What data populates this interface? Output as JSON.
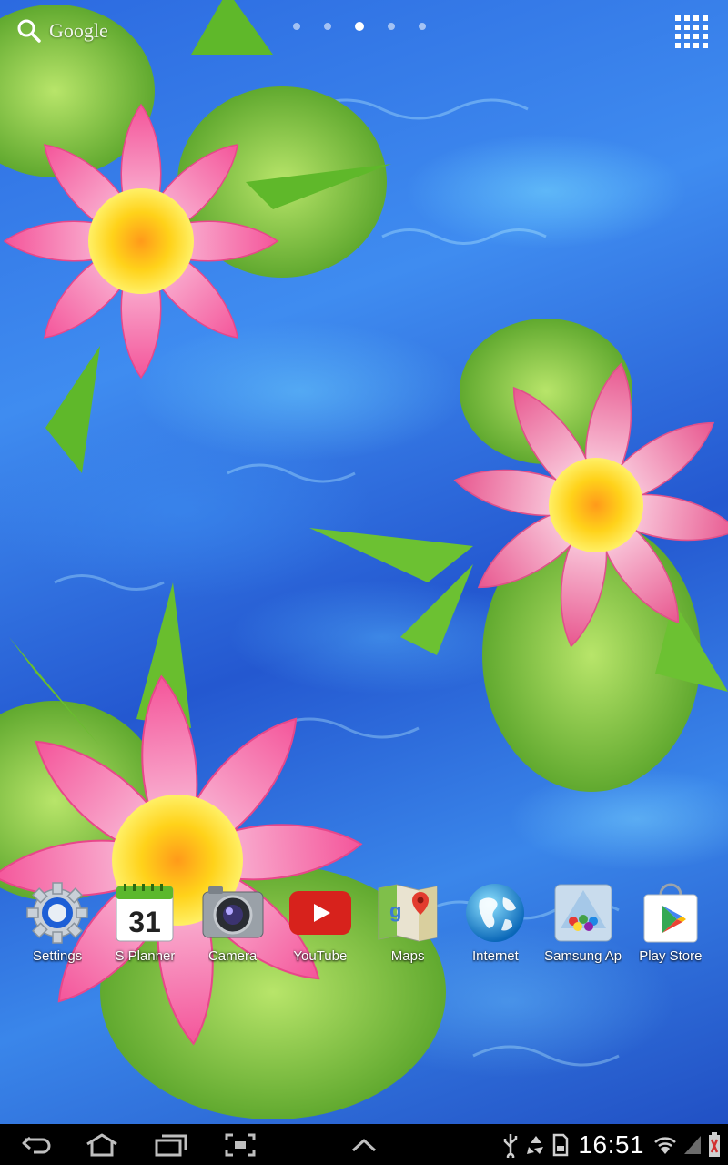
{
  "search": {
    "label": "Google",
    "icon": "search-icon"
  },
  "pages": {
    "count": 5,
    "active": 3
  },
  "dock": [
    {
      "label": "Settings",
      "icon": "settings-gear-icon"
    },
    {
      "label": "S Planner",
      "icon": "calendar-icon",
      "calendar_day": "31"
    },
    {
      "label": "Camera",
      "icon": "camera-icon"
    },
    {
      "label": "YouTube",
      "icon": "youtube-icon"
    },
    {
      "label": "Maps",
      "icon": "maps-icon"
    },
    {
      "label": "Internet",
      "icon": "globe-icon"
    },
    {
      "label": "Samsung Ap",
      "icon": "samsung-apps-icon"
    },
    {
      "label": "Play Store",
      "icon": "play-store-icon"
    }
  ],
  "status": {
    "time": "16:51",
    "icons": [
      "usb-icon",
      "recycle-icon",
      "sd-card-icon",
      "wifi-icon",
      "signal-icon",
      "battery-icon"
    ]
  },
  "colors": {
    "water": "#2c6ae0",
    "lotus_pink": "#f06aa8",
    "lotus_center": "#ffd21a",
    "leaf": "#7cc63a",
    "navbar": "#000000"
  }
}
